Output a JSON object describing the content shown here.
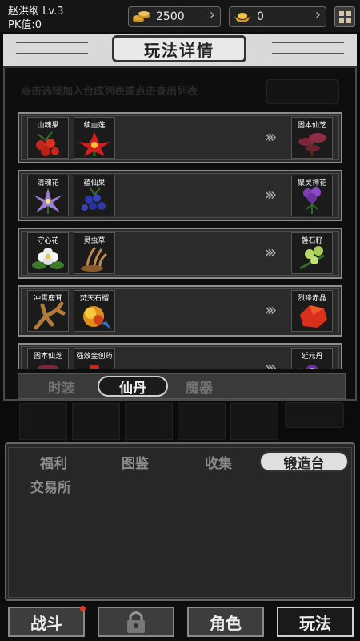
{
  "player": {
    "name": "赵洪纲",
    "level": "Lv.3",
    "pk": "PK值:0"
  },
  "resources": [
    {
      "icon": "coins-icon",
      "value": "2500"
    },
    {
      "icon": "gold-ingot-icon",
      "value": "0"
    }
  ],
  "dialog": {
    "title": "玩法详情",
    "hint": "点击选择加入合成列表或点击查出列表",
    "recipes": [
      {
        "inputs": [
          {
            "name": "山魂果",
            "icon": "red-berries-icon"
          },
          {
            "name": "续血莲",
            "icon": "red-lotus-icon"
          }
        ],
        "output": {
          "name": "固本仙芝",
          "icon": "lingzhi-icon"
        }
      },
      {
        "inputs": [
          {
            "name": "清魂花",
            "icon": "purple-flower-icon"
          },
          {
            "name": "蕴仙果",
            "icon": "blue-berries-icon"
          }
        ],
        "output": {
          "name": "聚灵神花",
          "icon": "violet-flower-icon"
        }
      },
      {
        "inputs": [
          {
            "name": "守心花",
            "icon": "white-flower-icon"
          },
          {
            "name": "灵虫草",
            "icon": "cordyceps-icon"
          }
        ],
        "output": {
          "name": "磐石籽",
          "icon": "green-seeds-icon"
        }
      },
      {
        "inputs": [
          {
            "name": "冲霄鹿茸",
            "icon": "antler-icon"
          },
          {
            "name": "焚天石榴",
            "icon": "fire-pomegranate-icon"
          }
        ],
        "output": {
          "name": "烈锋赤晶",
          "icon": "red-crystal-icon"
        }
      },
      {
        "inputs": [
          {
            "name": "固本仙芝",
            "icon": "lingzhi-icon"
          },
          {
            "name": "强效金创药",
            "icon": "medicine-icon"
          }
        ],
        "output": {
          "name": "延元丹",
          "icon": "elixir-icon"
        }
      }
    ],
    "tabs": [
      "时装",
      "仙丹",
      "魔器"
    ],
    "selected_tab": "仙丹"
  },
  "lower_tabs": [
    "福利",
    "图鉴",
    "收集",
    "锻造台",
    "交易所"
  ],
  "lower_selected": "锻造台",
  "bottom_nav": [
    {
      "label": "战斗",
      "badge": true
    },
    {
      "label": "",
      "icon": "lock-icon"
    },
    {
      "label": "角色"
    },
    {
      "label": "玩法",
      "selected": true
    }
  ],
  "colors": {
    "badge": "#e23a2b",
    "panel": "#272727"
  }
}
